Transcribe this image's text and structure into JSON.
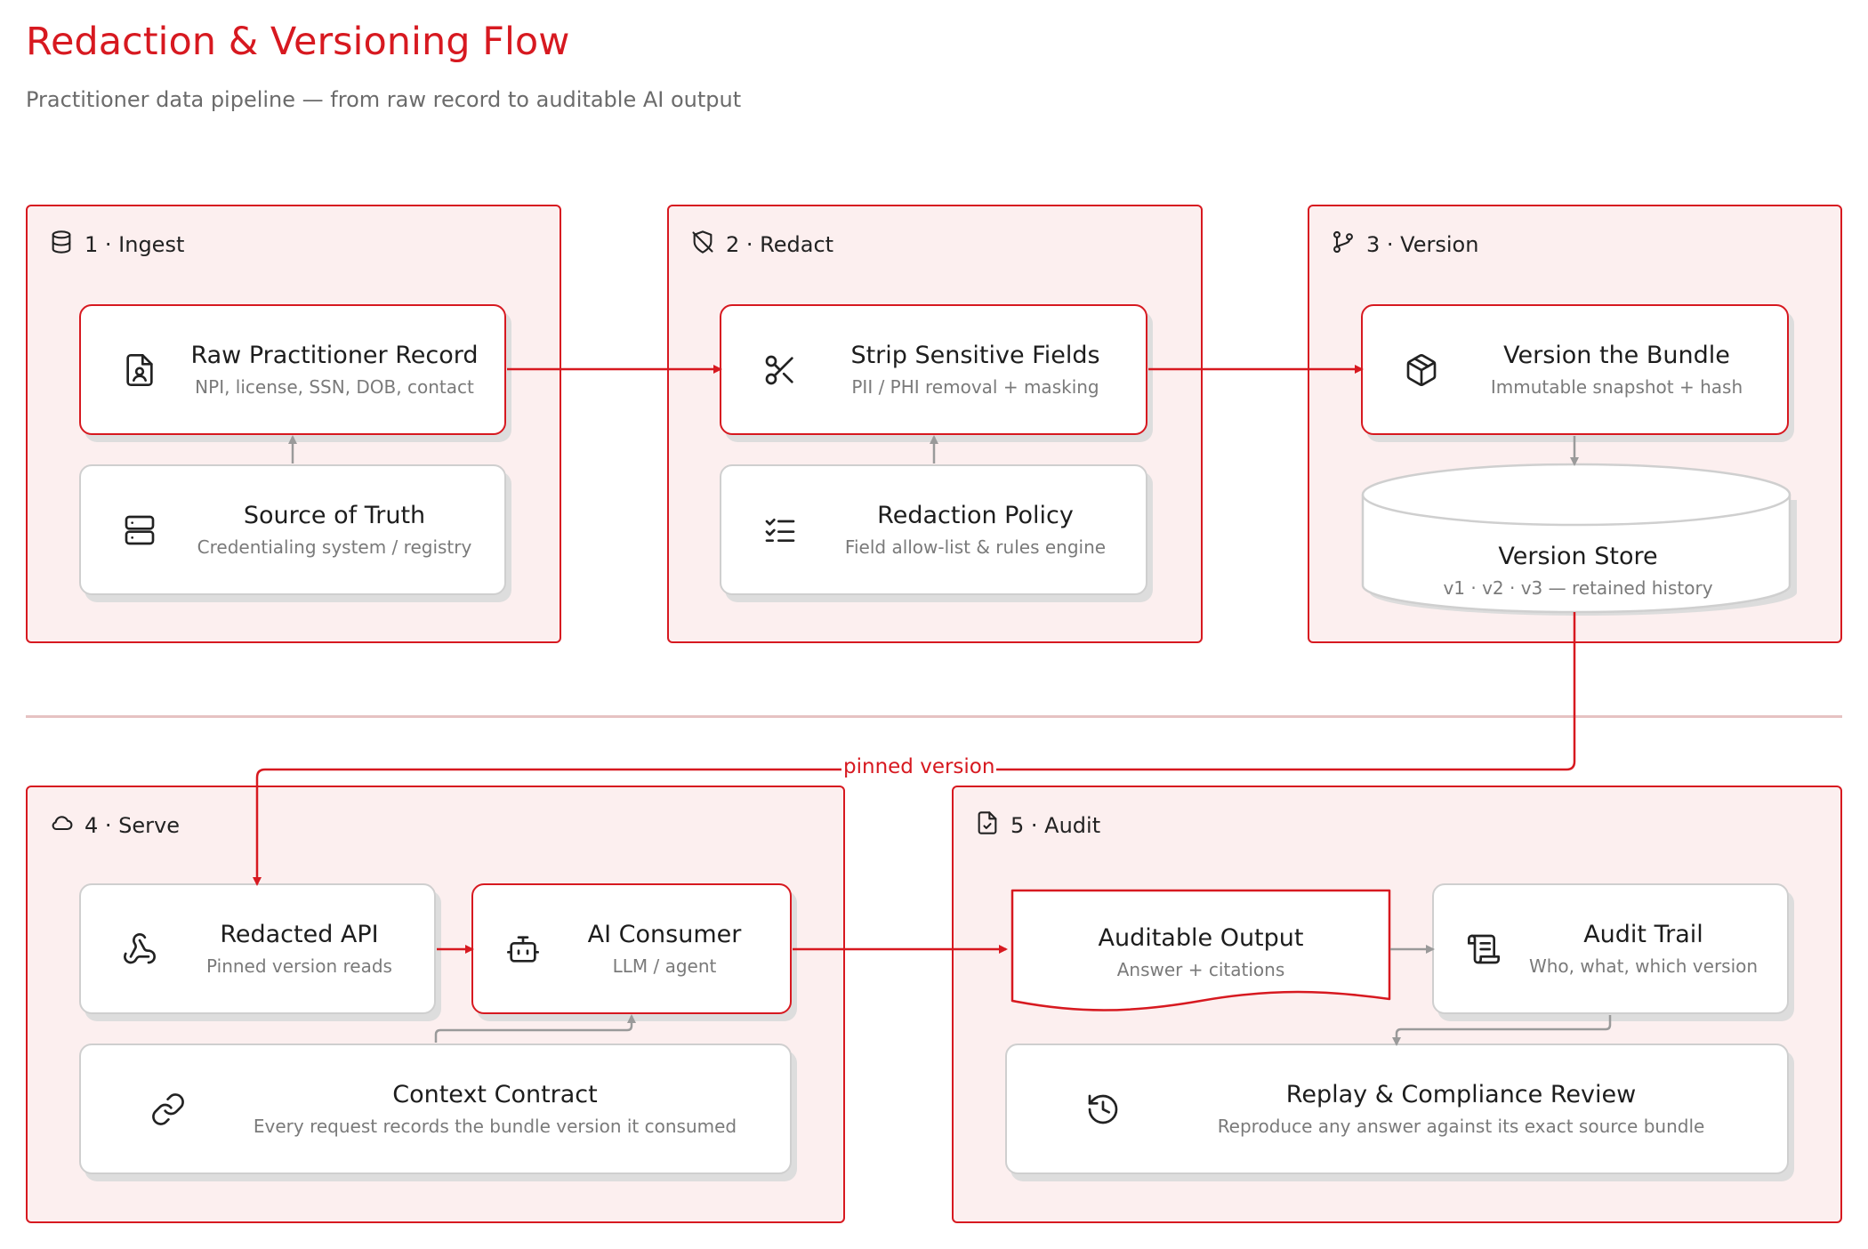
{
  "header": {
    "title": "Redaction & Versioning Flow",
    "subtitle": "Practitioner data pipeline — from raw record to auditable AI output"
  },
  "groups": {
    "ingest": {
      "label": "1 · Ingest",
      "icon": "database-icon"
    },
    "redact": {
      "label": "2 · Redact",
      "icon": "shield-off-icon"
    },
    "version": {
      "label": "3 · Version",
      "icon": "git-branch-icon"
    },
    "serve": {
      "label": "4 · Serve",
      "icon": "cloud-icon"
    },
    "audit": {
      "label": "5 · Audit",
      "icon": "file-check-icon"
    }
  },
  "nodes": {
    "raw_record": {
      "title": "Raw Practitioner Record",
      "subtitle": "NPI, license, SSN, DOB, contact",
      "icon": "file-user-icon"
    },
    "source_of_truth": {
      "title": "Source of Truth",
      "subtitle": "Credentialing system / registry",
      "icon": "server-icon"
    },
    "strip_fields": {
      "title": "Strip Sensitive Fields",
      "subtitle": "PII / PHI removal + masking",
      "icon": "scissors-icon"
    },
    "redaction_policy": {
      "title": "Redaction Policy",
      "subtitle": "Field allow-list & rules engine",
      "icon": "list-checks-icon"
    },
    "version_bundle": {
      "title": "Version the Bundle",
      "subtitle": "Immutable snapshot + hash",
      "icon": "package-icon"
    },
    "version_store": {
      "title": "Version Store",
      "subtitle": "v1 · v2 · v3 — retained history"
    },
    "redacted_api": {
      "title": "Redacted API",
      "subtitle": "Pinned version reads",
      "icon": "webhook-icon"
    },
    "ai_consumer": {
      "title": "AI Consumer",
      "subtitle": "LLM / agent",
      "icon": "bot-icon"
    },
    "context_contract": {
      "title": "Context Contract",
      "subtitle": "Every request records the bundle version it consumed",
      "icon": "link-icon"
    },
    "auditable_output": {
      "title": "Auditable Output",
      "subtitle": "Answer + citations"
    },
    "audit_trail": {
      "title": "Audit Trail",
      "subtitle": "Who, what, which version",
      "icon": "scroll-icon"
    },
    "replay_review": {
      "title": "Replay & Compliance Review",
      "subtitle": "Reproduce any answer against its exact source bundle",
      "icon": "history-icon"
    }
  },
  "edges": {
    "pinned_version_label": "pinned version"
  },
  "colors": {
    "accent": "#d71920",
    "group_fill": "#fcefef",
    "neutral_border": "#cfcfcf",
    "muted_text": "#7a7a7a",
    "neutral_edge": "#9a9a9a"
  }
}
